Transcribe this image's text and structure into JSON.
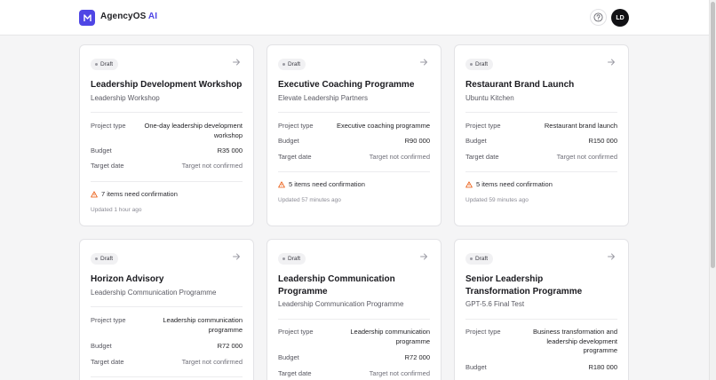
{
  "app": {
    "name": "AgencyOS",
    "name_suffix": "AI",
    "avatar_initials": "LD"
  },
  "colors": {
    "accent": "#4f46e5",
    "warning": "#ea580c",
    "badge_bg": "#f1f1f3"
  },
  "labels": {
    "status": "Draft",
    "project_type": "Project type",
    "budget": "Budget",
    "target_date": "Target date"
  },
  "cards": [
    {
      "title": "Leadership Development Workshop",
      "subtitle": "Leadership Workshop",
      "project_type": "One-day leadership development workshop",
      "budget": "R35 000",
      "target_date": "Target not confirmed",
      "warning": "7 items need confirmation",
      "updated": "Updated 1 hour ago"
    },
    {
      "title": "Executive Coaching Programme",
      "subtitle": "Elevate Leadership Partners",
      "project_type": "Executive coaching programme",
      "budget": "R90 000",
      "target_date": "Target not confirmed",
      "warning": "5 items need confirmation",
      "updated": "Updated 57 minutes ago"
    },
    {
      "title": "Restaurant Brand Launch",
      "subtitle": "Ubuntu Kitchen",
      "project_type": "Restaurant brand launch",
      "budget": "R150 000",
      "target_date": "Target not confirmed",
      "warning": "5 items need confirmation",
      "updated": "Updated 59 minutes ago"
    },
    {
      "title": "Horizon Advisory",
      "subtitle": "Leadership Communication Programme",
      "project_type": "Leadership communication programme",
      "budget": "R72 000",
      "target_date": "Target not confirmed"
    },
    {
      "title": "Leadership Communication Programme",
      "subtitle": "Leadership Communication Programme",
      "project_type": "Leadership communication programme",
      "budget": "R72 000",
      "target_date": "Target not confirmed"
    },
    {
      "title": "Senior Leadership Transformation Programme",
      "subtitle": "GPT-5.6 Final Test",
      "project_type": "Business transformation and leadership development programme",
      "budget": "R180 000"
    }
  ]
}
